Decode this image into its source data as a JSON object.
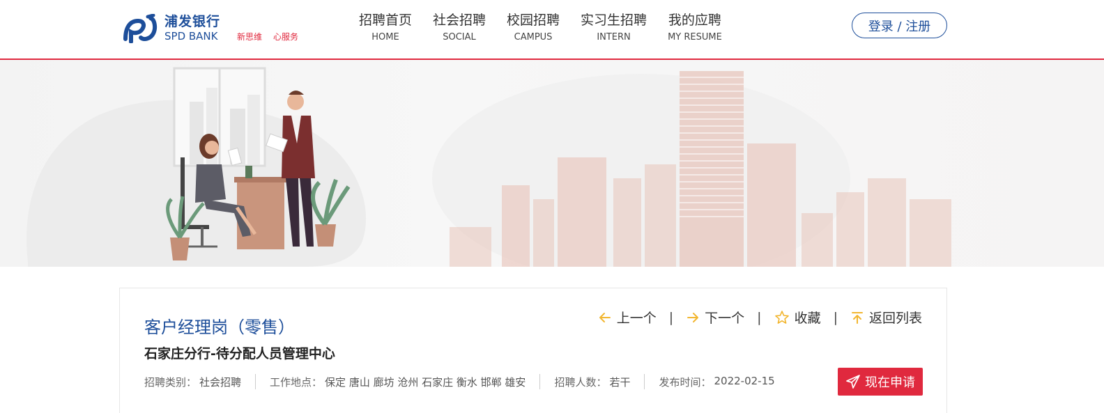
{
  "header": {
    "logo": {
      "cn": "浦发银行",
      "en": "SPD BANK"
    },
    "slogan": [
      "新思维",
      "心服务"
    ],
    "nav": [
      {
        "cn": "招聘首页",
        "en": "HOME"
      },
      {
        "cn": "社会招聘",
        "en": "SOCIAL"
      },
      {
        "cn": "校园招聘",
        "en": "CAMPUS"
      },
      {
        "cn": "实习生招聘",
        "en": "INTERN"
      },
      {
        "cn": "我的应聘",
        "en": "MY RESUME"
      }
    ],
    "login_label": "登录 / 注册"
  },
  "job": {
    "title": "客户经理岗（零售）",
    "department": "石家庄分行-待分配人员管理中心",
    "actions": {
      "prev": "上一个",
      "next": "下一个",
      "favorite": "收藏",
      "back": "返回列表"
    },
    "meta": {
      "category_label": "招聘类别：",
      "category_value": "社会招聘",
      "location_label": "工作地点：",
      "location_value": "保定 唐山 廊坊 沧州 石家庄 衡水 邯郸 雄安",
      "count_label": "招聘人数：",
      "count_value": "若干",
      "date_label": "发布时间：",
      "date_value": "2022-02-15"
    },
    "apply_label": "现在申请"
  },
  "colors": {
    "brand_blue": "#1d4e9a",
    "brand_red": "#e0293e",
    "icon_yellow": "#f2b630"
  }
}
